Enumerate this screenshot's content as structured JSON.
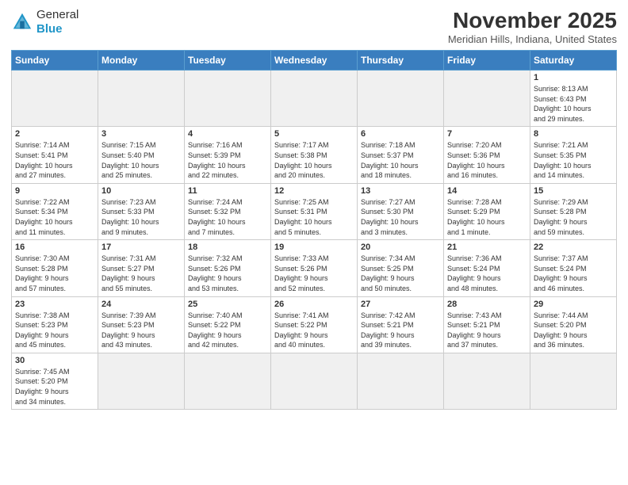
{
  "logo": {
    "general": "General",
    "blue": "Blue"
  },
  "title": "November 2025",
  "location": "Meridian Hills, Indiana, United States",
  "days_of_week": [
    "Sunday",
    "Monday",
    "Tuesday",
    "Wednesday",
    "Thursday",
    "Friday",
    "Saturday"
  ],
  "weeks": [
    [
      {
        "day": "",
        "info": ""
      },
      {
        "day": "",
        "info": ""
      },
      {
        "day": "",
        "info": ""
      },
      {
        "day": "",
        "info": ""
      },
      {
        "day": "",
        "info": ""
      },
      {
        "day": "",
        "info": ""
      },
      {
        "day": "1",
        "info": "Sunrise: 8:13 AM\nSunset: 6:43 PM\nDaylight: 10 hours\nand 29 minutes."
      }
    ],
    [
      {
        "day": "2",
        "info": "Sunrise: 7:14 AM\nSunset: 5:41 PM\nDaylight: 10 hours\nand 27 minutes."
      },
      {
        "day": "3",
        "info": "Sunrise: 7:15 AM\nSunset: 5:40 PM\nDaylight: 10 hours\nand 25 minutes."
      },
      {
        "day": "4",
        "info": "Sunrise: 7:16 AM\nSunset: 5:39 PM\nDaylight: 10 hours\nand 22 minutes."
      },
      {
        "day": "5",
        "info": "Sunrise: 7:17 AM\nSunset: 5:38 PM\nDaylight: 10 hours\nand 20 minutes."
      },
      {
        "day": "6",
        "info": "Sunrise: 7:18 AM\nSunset: 5:37 PM\nDaylight: 10 hours\nand 18 minutes."
      },
      {
        "day": "7",
        "info": "Sunrise: 7:20 AM\nSunset: 5:36 PM\nDaylight: 10 hours\nand 16 minutes."
      },
      {
        "day": "8",
        "info": "Sunrise: 7:21 AM\nSunset: 5:35 PM\nDaylight: 10 hours\nand 14 minutes."
      }
    ],
    [
      {
        "day": "9",
        "info": "Sunrise: 7:22 AM\nSunset: 5:34 PM\nDaylight: 10 hours\nand 11 minutes."
      },
      {
        "day": "10",
        "info": "Sunrise: 7:23 AM\nSunset: 5:33 PM\nDaylight: 10 hours\nand 9 minutes."
      },
      {
        "day": "11",
        "info": "Sunrise: 7:24 AM\nSunset: 5:32 PM\nDaylight: 10 hours\nand 7 minutes."
      },
      {
        "day": "12",
        "info": "Sunrise: 7:25 AM\nSunset: 5:31 PM\nDaylight: 10 hours\nand 5 minutes."
      },
      {
        "day": "13",
        "info": "Sunrise: 7:27 AM\nSunset: 5:30 PM\nDaylight: 10 hours\nand 3 minutes."
      },
      {
        "day": "14",
        "info": "Sunrise: 7:28 AM\nSunset: 5:29 PM\nDaylight: 10 hours\nand 1 minute."
      },
      {
        "day": "15",
        "info": "Sunrise: 7:29 AM\nSunset: 5:28 PM\nDaylight: 9 hours\nand 59 minutes."
      }
    ],
    [
      {
        "day": "16",
        "info": "Sunrise: 7:30 AM\nSunset: 5:28 PM\nDaylight: 9 hours\nand 57 minutes."
      },
      {
        "day": "17",
        "info": "Sunrise: 7:31 AM\nSunset: 5:27 PM\nDaylight: 9 hours\nand 55 minutes."
      },
      {
        "day": "18",
        "info": "Sunrise: 7:32 AM\nSunset: 5:26 PM\nDaylight: 9 hours\nand 53 minutes."
      },
      {
        "day": "19",
        "info": "Sunrise: 7:33 AM\nSunset: 5:26 PM\nDaylight: 9 hours\nand 52 minutes."
      },
      {
        "day": "20",
        "info": "Sunrise: 7:34 AM\nSunset: 5:25 PM\nDaylight: 9 hours\nand 50 minutes."
      },
      {
        "day": "21",
        "info": "Sunrise: 7:36 AM\nSunset: 5:24 PM\nDaylight: 9 hours\nand 48 minutes."
      },
      {
        "day": "22",
        "info": "Sunrise: 7:37 AM\nSunset: 5:24 PM\nDaylight: 9 hours\nand 46 minutes."
      }
    ],
    [
      {
        "day": "23",
        "info": "Sunrise: 7:38 AM\nSunset: 5:23 PM\nDaylight: 9 hours\nand 45 minutes."
      },
      {
        "day": "24",
        "info": "Sunrise: 7:39 AM\nSunset: 5:23 PM\nDaylight: 9 hours\nand 43 minutes."
      },
      {
        "day": "25",
        "info": "Sunrise: 7:40 AM\nSunset: 5:22 PM\nDaylight: 9 hours\nand 42 minutes."
      },
      {
        "day": "26",
        "info": "Sunrise: 7:41 AM\nSunset: 5:22 PM\nDaylight: 9 hours\nand 40 minutes."
      },
      {
        "day": "27",
        "info": "Sunrise: 7:42 AM\nSunset: 5:21 PM\nDaylight: 9 hours\nand 39 minutes."
      },
      {
        "day": "28",
        "info": "Sunrise: 7:43 AM\nSunset: 5:21 PM\nDaylight: 9 hours\nand 37 minutes."
      },
      {
        "day": "29",
        "info": "Sunrise: 7:44 AM\nSunset: 5:20 PM\nDaylight: 9 hours\nand 36 minutes."
      }
    ],
    [
      {
        "day": "30",
        "info": "Sunrise: 7:45 AM\nSunset: 5:20 PM\nDaylight: 9 hours\nand 34 minutes."
      },
      {
        "day": "",
        "info": ""
      },
      {
        "day": "",
        "info": ""
      },
      {
        "day": "",
        "info": ""
      },
      {
        "day": "",
        "info": ""
      },
      {
        "day": "",
        "info": ""
      },
      {
        "day": "",
        "info": ""
      }
    ]
  ]
}
